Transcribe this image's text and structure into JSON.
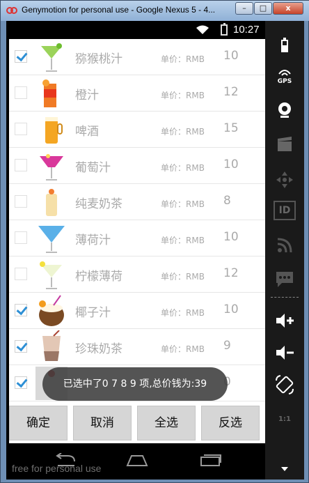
{
  "window": {
    "title": "Genymotion for personal use - Google Nexus 5 - 4...",
    "min_label": "–",
    "max_label": "□",
    "close_label": "x"
  },
  "statusbar": {
    "time": "10:27"
  },
  "items": [
    {
      "name": "猕猴桃汁",
      "unit_label": "单价：RMB",
      "price": "10",
      "checked": true
    },
    {
      "name": "橙汁",
      "unit_label": "单价：RMB",
      "price": "12",
      "checked": false
    },
    {
      "name": "啤酒",
      "unit_label": "单价：RMB",
      "price": "15",
      "checked": false
    },
    {
      "name": "葡萄汁",
      "unit_label": "单价：RMB",
      "price": "10",
      "checked": false
    },
    {
      "name": "纯麦奶茶",
      "unit_label": "单价：RMB",
      "price": "8",
      "checked": false
    },
    {
      "name": "薄荷汁",
      "unit_label": "单价：RMB",
      "price": "10",
      "checked": false
    },
    {
      "name": "柠檬薄荷",
      "unit_label": "单价：RMB",
      "price": "12",
      "checked": false
    },
    {
      "name": "椰子汁",
      "unit_label": "单价：RMB",
      "price": "10",
      "checked": true
    },
    {
      "name": "珍珠奶茶",
      "unit_label": "单价：RMB",
      "price": "9",
      "checked": true
    },
    {
      "name": "",
      "unit_label": "",
      "price": "0",
      "checked": true
    }
  ],
  "toast": {
    "text": "已选中了0 7 8 9 项,总价钱为:39"
  },
  "buttons": {
    "confirm": "确定",
    "cancel": "取消",
    "select_all": "全选",
    "invert": "反选"
  },
  "sidebar": {
    "gps_label": "GPS",
    "id_label": "ID",
    "zoom_label": "1:1"
  },
  "watermark": "free for personal use",
  "colors": {
    "accent_check": "#2d8fd5",
    "toast_bg": "#3c3c3c",
    "button_bg": "#d6d6d6"
  }
}
